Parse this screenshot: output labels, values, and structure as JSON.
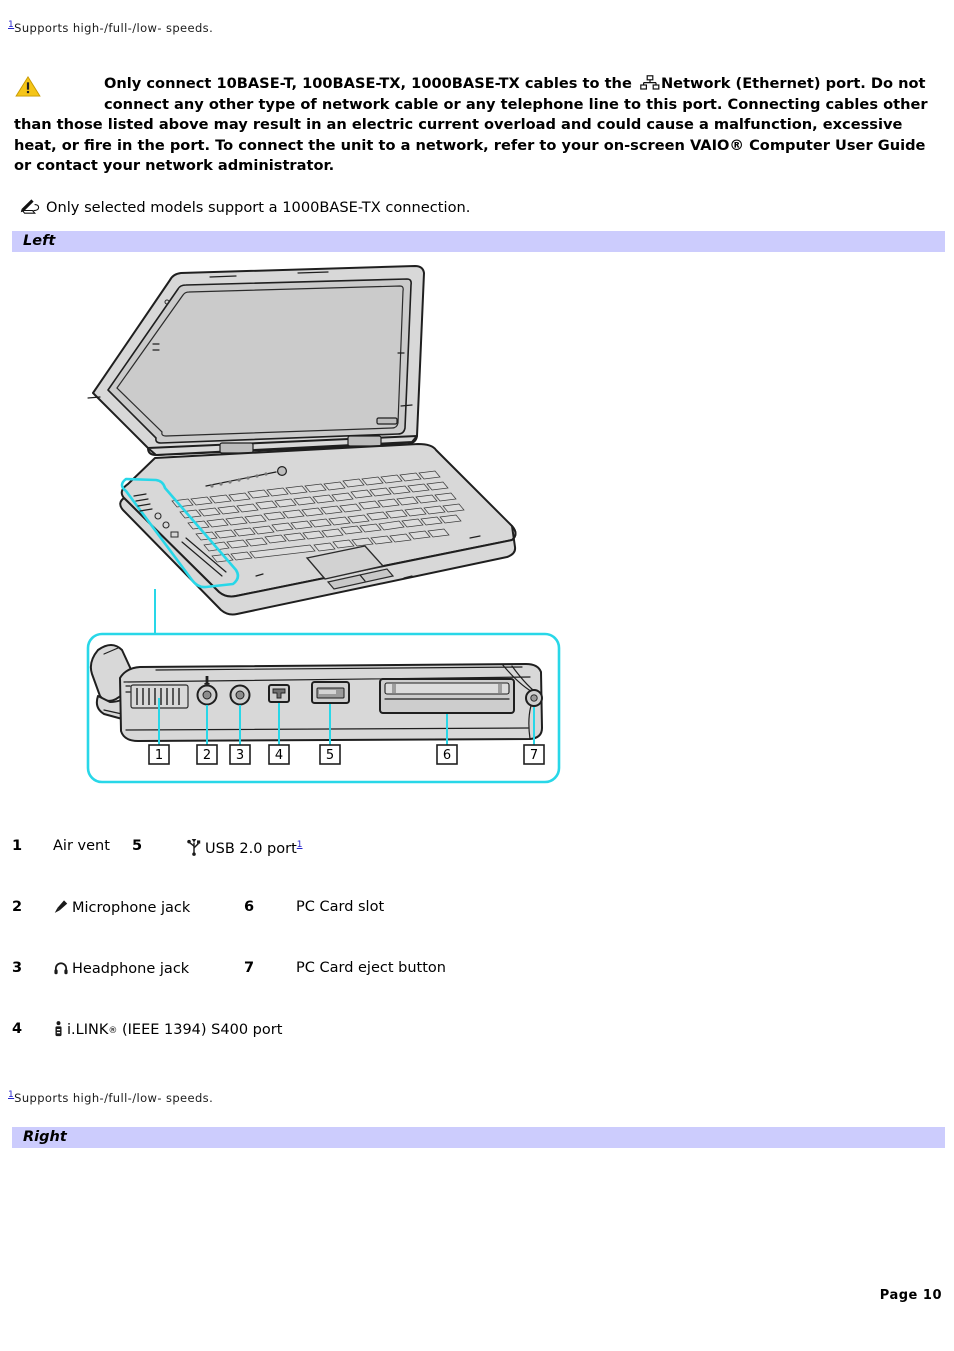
{
  "footnotes": {
    "top": {
      "marker": "1",
      "text": "Supports high-/full-/low- speeds."
    },
    "bottom": {
      "marker": "1",
      "text": "Supports high-/full-/low- speeds."
    }
  },
  "warning": {
    "icon": "warning-triangle-icon",
    "network_icon": "network-ethernet-icon",
    "text_before_icon": "Only connect 10BASE-T, 100BASE-TX, 1000BASE-TX cables to the",
    "text_after_icon": "Network (Ethernet) port. Do not connect any other type of network cable or any telephone line to this port. Connecting cables other than those listed above may result in an electric current overload and could cause a malfunction, excessive heat, or fire in the port. To connect the unit to a network, refer to your on-screen VAIO® Computer User Guide or contact your network administrator."
  },
  "note": {
    "icon": "note-pencil-icon",
    "text": "Only selected models support a 1000BASE-TX connection."
  },
  "sections": {
    "left": "Left",
    "right": "Right"
  },
  "illustration": {
    "name": "laptop-left-side-diagram",
    "highlight_color": "#28d7e8",
    "body_fill": "#d9d9d9",
    "screen_fill": "#cfcfcf",
    "outline_color": "#1a1a1a",
    "callouts": [
      "1",
      "2",
      "3",
      "4",
      "5",
      "6",
      "7"
    ]
  },
  "legend": {
    "rows": [
      {
        "left": {
          "num": "1",
          "icon": null,
          "label": "Air vent"
        },
        "right": {
          "num": "5",
          "icon": "usb-icon",
          "label": "USB 2.0 port",
          "footnote": "1"
        }
      },
      {
        "left": {
          "num": "2",
          "icon": "microphone-icon",
          "label": "Microphone jack"
        },
        "right": {
          "num": "6",
          "icon": null,
          "label": "PC Card slot"
        }
      },
      {
        "left": {
          "num": "3",
          "icon": "headphone-icon",
          "label": "Headphone jack"
        },
        "right": {
          "num": "7",
          "icon": null,
          "label": "PC Card eject button"
        }
      },
      {
        "left": {
          "num": "4",
          "icon": "ilink-icon",
          "label_pre": "i.LINK",
          "label_reg": "®",
          "label_post": " (IEEE 1394) S400 port"
        },
        "right": null
      }
    ]
  },
  "footer": {
    "page_label": "Page 10"
  },
  "colors": {
    "section_bar": "#ccccfd",
    "link_blue": "#2222cc",
    "warning_yellow": "#f5c518",
    "callout_cyan": "#28d7e8"
  }
}
